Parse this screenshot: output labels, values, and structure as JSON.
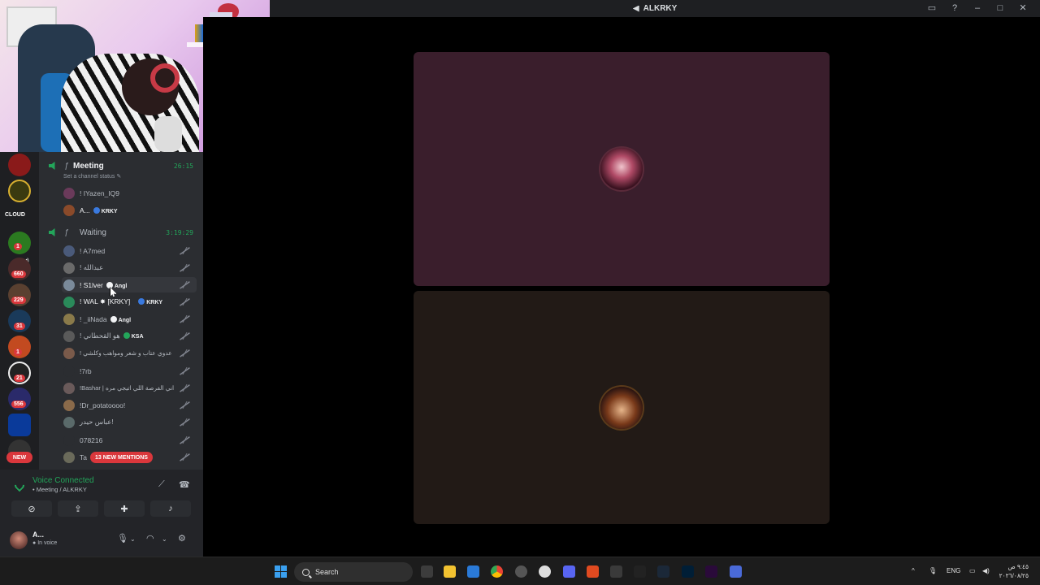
{
  "window": {
    "title": "ALKRKY"
  },
  "servers": {
    "badges": [
      "1",
      "660",
      "229",
      "31",
      "1",
      "21",
      "556"
    ],
    "labels": [
      "CLOUD"
    ],
    "new_label": "NEW"
  },
  "channels": {
    "meeting": {
      "name": "Meeting",
      "prefix": "ƒ",
      "timer": "26:15",
      "status": "Set a channel status"
    },
    "meeting_users": [
      {
        "name": "! IYazen_IQ9",
        "tag": ""
      },
      {
        "name": "A...",
        "tag": "KRKY"
      }
    ],
    "waiting": {
      "name": "Waiting",
      "prefix": "ƒ",
      "timer": "3:19:29"
    },
    "waiting_users": [
      {
        "name": "! A7med",
        "tag": ""
      },
      {
        "name": "! عبدالله",
        "tag": ""
      },
      {
        "name": "! S1lver",
        "tag": "Angl"
      },
      {
        "name": "! WAL ✸ [KRKY]",
        "tag": "KRKY"
      },
      {
        "name": "! _iiNada",
        "tag": "Angl"
      },
      {
        "name": "! هو القحطاني",
        "tag": "KSA"
      },
      {
        "name": "! عدوي عتاب و شعر ومواهب وكلشي",
        "tag": ""
      },
      {
        "name": "!7rb",
        "tag": ""
      },
      {
        "name": "!Bashar | اني الفرصة اللي اتيجي مره",
        "tag": ""
      },
      {
        "name": "!Dr_potatoooo!",
        "tag": ""
      },
      {
        "name": "عباس حيدر!",
        "tag": ""
      },
      {
        "name": "078216",
        "tag": ""
      },
      {
        "name": "Ta",
        "tag": ""
      }
    ],
    "mentions_pill": "13 NEW MENTIONS"
  },
  "voice": {
    "title": "Voice Connected",
    "subtitle": "Meeting / ALKRKY"
  },
  "user_panel": {
    "name": "A...",
    "status": "In voice"
  },
  "taskbar": {
    "search_label": "Search",
    "language": "ENG",
    "time": "٩:٤٥ ص",
    "date": "٢٠٢٦/٠٨/٢٥"
  }
}
